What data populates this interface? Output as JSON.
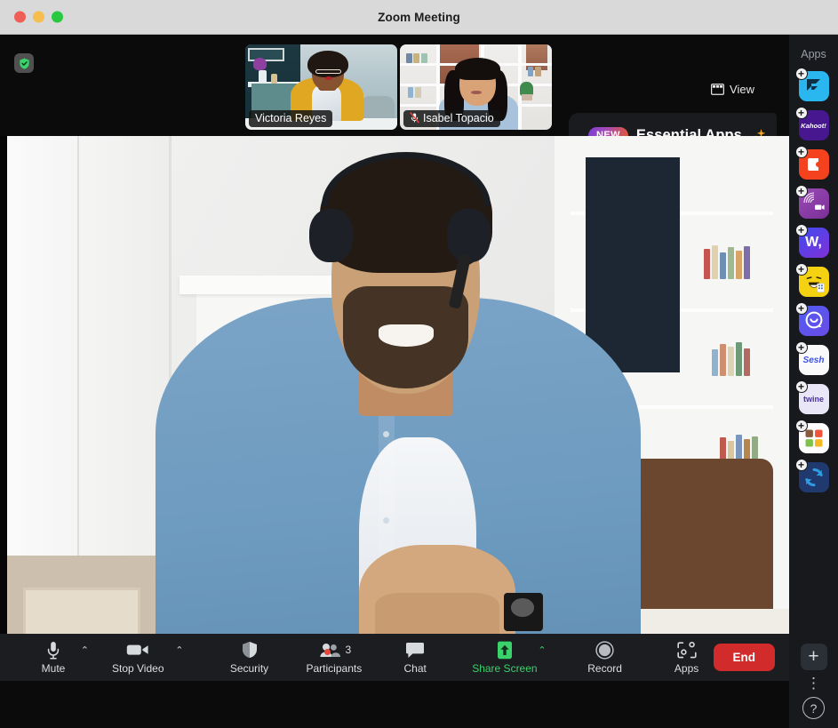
{
  "window": {
    "title": "Zoom Meeting",
    "traffic_lights": [
      "close",
      "minimize",
      "maximize"
    ]
  },
  "stage": {
    "encryption_icon": "shield-check-icon",
    "view_button": {
      "label": "View",
      "icon": "layout-grid-icon"
    },
    "thumbnails": [
      {
        "name": "Victoria Reyes",
        "muted": false,
        "mute_icon": ""
      },
      {
        "name": "Isabel Topacio",
        "muted": true,
        "mute_icon": "mic-muted-icon"
      }
    ],
    "promo_banner": {
      "badge": "NEW",
      "label": "Essential Apps",
      "icon": "sparkle-icon",
      "badge_gradient_from": "#7b3fd4",
      "badge_gradient_to": "#e2582a"
    },
    "active_speaker": {
      "description": "man-with-headphones-video"
    }
  },
  "apps_panel": {
    "title": "Apps",
    "items": [
      {
        "name": "funnel-app-icon",
        "label": "F",
        "bg": "#2ab7f0",
        "fg": "#0b3d57",
        "kind": "glyph"
      },
      {
        "name": "kahoot-app-icon",
        "label": "Kahoot!",
        "bg": "#46178f",
        "fg": "#ffffff",
        "kind": "word"
      },
      {
        "name": "puzzle-app-icon",
        "label": "",
        "bg": "#f4421e",
        "fg": "#ffffff",
        "kind": "puzzle"
      },
      {
        "name": "video-app-icon",
        "label": "",
        "bg": "#8a3fa6",
        "fg": "#ffffff",
        "kind": "burst"
      },
      {
        "name": "w-app-icon",
        "label": "W,",
        "bg": "#3b4cf0",
        "fg": "#ffffff",
        "kind": "word"
      },
      {
        "name": "emoji-app-icon",
        "label": "",
        "bg": "#f5d211",
        "fg": "#1a1a1a",
        "kind": "emoji"
      },
      {
        "name": "smile-app-icon",
        "label": "",
        "bg": "#4f5df2",
        "fg": "#ffffff",
        "kind": "smile"
      },
      {
        "name": "sesh-app-icon",
        "label": "Sesh",
        "bg": "#ffffff",
        "fg": "#3a51e8",
        "kind": "word"
      },
      {
        "name": "twine-app-icon",
        "label": "twine",
        "bg": "#e9e6f7",
        "fg": "#4b2fa8",
        "kind": "word"
      },
      {
        "name": "grid-app-icon",
        "label": "",
        "bg": "#ffffff",
        "fg": "#000000",
        "kind": "grid"
      },
      {
        "name": "sync-app-icon",
        "label": "",
        "bg": "#203a70",
        "fg": "#2f9be0",
        "kind": "sync"
      }
    ],
    "add_badge": "+",
    "add_button": "+",
    "more_button": "⋮",
    "help_button": "?"
  },
  "toolbar": {
    "items": [
      {
        "name": "mute-button",
        "label": "Mute",
        "icon": "microphone-icon",
        "has_chevron": true,
        "accent": "#dcdee1"
      },
      {
        "name": "stop-video-button",
        "label": "Stop Video",
        "icon": "video-camera-icon",
        "has_chevron": true,
        "accent": "#dcdee1"
      },
      {
        "name": "security-button",
        "label": "Security",
        "icon": "shield-icon",
        "has_chevron": false,
        "accent": "#dcdee1"
      },
      {
        "name": "participants-button",
        "label": "Participants",
        "icon": "people-icon",
        "has_chevron": false,
        "accent": "#dcdee1",
        "count": "3",
        "badge": true
      },
      {
        "name": "chat-button",
        "label": "Chat",
        "icon": "chat-bubble-icon",
        "has_chevron": false,
        "accent": "#dcdee1"
      },
      {
        "name": "share-screen-button",
        "label": "Share Screen",
        "icon": "share-arrow-icon",
        "has_chevron": true,
        "accent": "#3ad26a"
      },
      {
        "name": "record-button",
        "label": "Record",
        "icon": "record-circle-icon",
        "has_chevron": false,
        "accent": "#dcdee1"
      },
      {
        "name": "apps-button",
        "label": "Apps",
        "icon": "apps-frame-icon",
        "has_chevron": false,
        "accent": "#dcdee1"
      }
    ],
    "end_button": {
      "label": "End",
      "color": "#d22b2b"
    }
  }
}
